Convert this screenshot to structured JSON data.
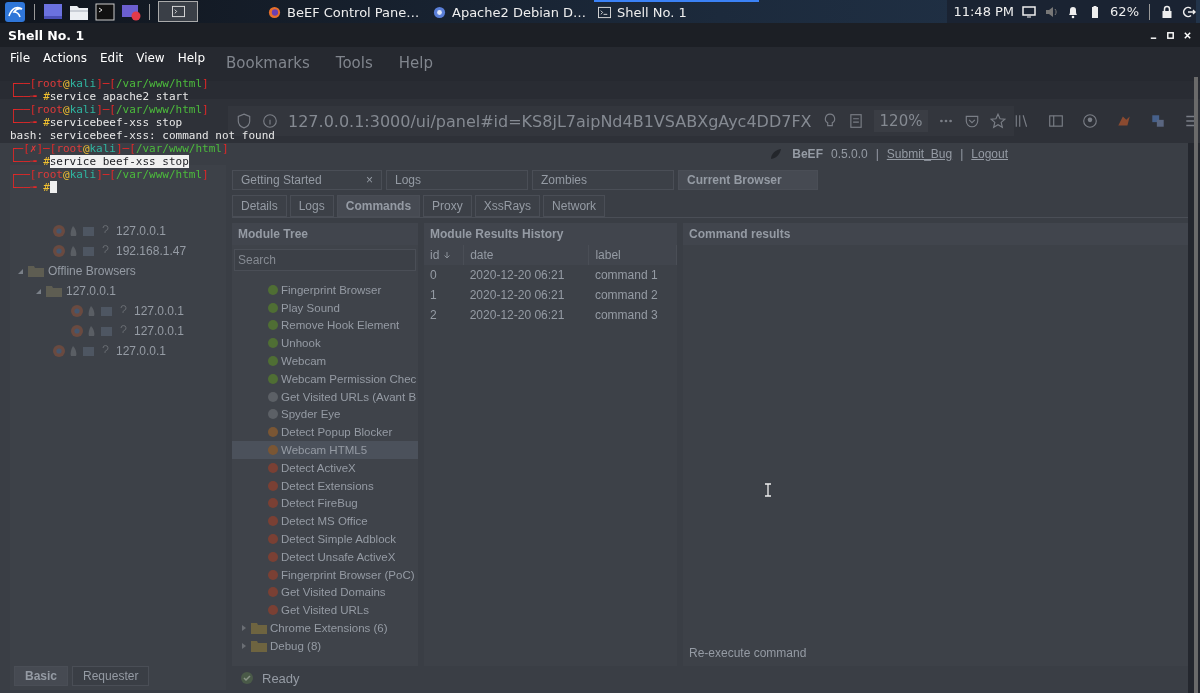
{
  "panel": {
    "tasks": [
      {
        "label": "BeEF Control Pane…",
        "kind": "browser",
        "selected": false
      },
      {
        "label": "Apache2 Debian D…",
        "kind": "web",
        "selected": false
      },
      {
        "label": "Shell No. 1",
        "kind": "terminal",
        "selected": true
      }
    ],
    "clock": "11:48 PM",
    "battery": "62%"
  },
  "browser": {
    "menu": [
      "Bookmarks",
      "Tools",
      "Help"
    ],
    "url": "127.0.0.1:3000/ui/panel#id=KS8jL7aipNd4B1VSABXgAyc4DD7FX",
    "zoom": "120%",
    "beef": {
      "header": [
        "BeEF",
        "0.5.0.0",
        "|",
        "Submit_Bug",
        "|",
        "Logout"
      ],
      "online_browsers": [
        "127.0.0.1",
        "192.168.1.47"
      ],
      "tree": [
        {
          "label": "Offline Browsers",
          "expanded": true,
          "children": [
            {
              "label": "127.0.0.1",
              "expanded": true,
              "children": [
                {
                  "label": "127.0.0.1"
                },
                {
                  "label": "127.0.0.1"
                }
              ]
            },
            {
              "label": "127.0.0.1"
            }
          ]
        }
      ],
      "bottom_tabs": [
        {
          "label": "Basic",
          "selected": true
        },
        {
          "label": "Requester",
          "selected": false
        }
      ],
      "tabs": [
        {
          "label": "Getting Started",
          "selected": false,
          "close": "×"
        },
        {
          "label": "Logs",
          "selected": false
        },
        {
          "label": "Zombies",
          "selected": false
        },
        {
          "label": "Current Browser",
          "selected": true
        }
      ],
      "subtabs": [
        {
          "label": "Details",
          "selected": false
        },
        {
          "label": "Logs",
          "selected": false
        },
        {
          "label": "Commands",
          "selected": true
        },
        {
          "label": "Proxy",
          "selected": false
        },
        {
          "label": "XssRays",
          "selected": false
        },
        {
          "label": "Network",
          "selected": false
        }
      ],
      "module_tree": {
        "title": "Module Tree",
        "placeholder": "Search",
        "items": [
          {
            "kind": "module",
            "label": "Fingerprint Browser",
            "color": "#4f6e34",
            "selected": false
          },
          {
            "kind": "module",
            "label": "Play Sound",
            "color": "#4f6e34",
            "selected": false
          },
          {
            "kind": "module",
            "label": "Remove Hook Element",
            "color": "#4f6e34",
            "selected": false
          },
          {
            "kind": "module",
            "label": "Unhook",
            "color": "#4f6e34",
            "selected": false
          },
          {
            "kind": "module",
            "label": "Webcam",
            "color": "#4f6e34",
            "selected": false
          },
          {
            "kind": "module",
            "label": "Webcam Permission Chec",
            "color": "#4f6e34",
            "selected": false
          },
          {
            "kind": "module",
            "label": "Get Visited URLs (Avant B",
            "color": "#5c6066",
            "selected": false
          },
          {
            "kind": "module",
            "label": "Spyder Eye",
            "color": "#5c6066",
            "selected": false
          },
          {
            "kind": "module",
            "label": "Detect Popup Blocker",
            "color": "#7a5634",
            "selected": false
          },
          {
            "kind": "module",
            "label": "Webcam HTML5",
            "color": "#7a5634",
            "selected": true
          },
          {
            "kind": "module",
            "label": "Detect ActiveX",
            "color": "#7a4034",
            "selected": false
          },
          {
            "kind": "module",
            "label": "Detect Extensions",
            "color": "#7a4034",
            "selected": false
          },
          {
            "kind": "module",
            "label": "Detect FireBug",
            "color": "#7a4034",
            "selected": false
          },
          {
            "kind": "module",
            "label": "Detect MS Office",
            "color": "#7a4034",
            "selected": false
          },
          {
            "kind": "module",
            "label": "Detect Simple Adblock",
            "color": "#7a4034",
            "selected": false
          },
          {
            "kind": "module",
            "label": "Detect Unsafe ActiveX",
            "color": "#7a4034",
            "selected": false
          },
          {
            "kind": "module",
            "label": "Fingerprint Browser (PoC)",
            "color": "#7a4034",
            "selected": false
          },
          {
            "kind": "module",
            "label": "Get Visited Domains",
            "color": "#7a4034",
            "selected": false
          },
          {
            "kind": "module",
            "label": "Get Visited URLs",
            "color": "#7a4034",
            "selected": false
          },
          {
            "kind": "folder",
            "label": "Chrome Extensions (6)",
            "selected": false
          },
          {
            "kind": "folder",
            "label": "Debug (8)",
            "selected": false
          }
        ]
      },
      "results": {
        "title": "Module Results History",
        "columns": [
          "id",
          "date",
          "label"
        ],
        "rows": [
          [
            "0",
            "2020-12-20 06:21",
            "command 1"
          ],
          [
            "1",
            "2020-12-20 06:21",
            "command 2"
          ],
          [
            "2",
            "2020-12-20 06:21",
            "command 3"
          ]
        ]
      },
      "command": {
        "title": "Command results",
        "action": "Re-execute command"
      },
      "status": "Ready"
    }
  },
  "terminal": {
    "title": "Shell No. 1",
    "menu": [
      "File",
      "Actions",
      "Edit",
      "View",
      "Help"
    ],
    "lines": [
      {
        "cursor": false,
        "parts": [
          {
            "t": "┌──[",
            "kind": "frame"
          },
          {
            "t": "root",
            "kind": "user"
          },
          {
            "t": "@",
            "kind": "at"
          },
          {
            "t": "kali",
            "kind": "host"
          },
          {
            "t": "]─[",
            "kind": "frame"
          },
          {
            "t": "/var/www/html",
            "kind": "path"
          },
          {
            "t": "]",
            "kind": "frame"
          }
        ]
      },
      {
        "cursor": false,
        "parts": [
          {
            "t": "└──╼ ",
            "kind": "frame"
          },
          {
            "t": "#",
            "kind": "at"
          },
          {
            "t": "service apache2 start",
            "kind": "text"
          }
        ]
      },
      {
        "cursor": false,
        "parts": [
          {
            "t": "┌──[",
            "kind": "frame"
          },
          {
            "t": "root",
            "kind": "user"
          },
          {
            "t": "@",
            "kind": "at"
          },
          {
            "t": "kali",
            "kind": "host"
          },
          {
            "t": "]─[",
            "kind": "frame"
          },
          {
            "t": "/var/www/html",
            "kind": "path"
          },
          {
            "t": "]",
            "kind": "frame"
          }
        ]
      },
      {
        "cursor": false,
        "parts": [
          {
            "t": "└──╼ ",
            "kind": "frame"
          },
          {
            "t": "#",
            "kind": "at"
          },
          {
            "t": "servicebeef-xss stop",
            "kind": "text"
          }
        ]
      },
      {
        "cursor": false,
        "parts": [
          {
            "t": "bash: servicebeef-xss: command not found",
            "kind": "text"
          }
        ]
      },
      {
        "cursor": false,
        "parts": [
          {
            "t": "┌─[",
            "kind": "frame"
          },
          {
            "t": "✗",
            "kind": "user"
          },
          {
            "t": "]─[",
            "kind": "frame"
          },
          {
            "t": "root",
            "kind": "user"
          },
          {
            "t": "@",
            "kind": "at"
          },
          {
            "t": "kali",
            "kind": "host"
          },
          {
            "t": "]─[",
            "kind": "frame"
          },
          {
            "t": "/var/www/html",
            "kind": "path"
          },
          {
            "t": "]",
            "kind": "frame"
          }
        ]
      },
      {
        "cursor": false,
        "parts": [
          {
            "t": "└──╼ ",
            "kind": "frame"
          },
          {
            "t": "#",
            "kind": "at"
          },
          {
            "t": "service beef-xss stop",
            "kind": "selected"
          }
        ]
      },
      {
        "cursor": false,
        "parts": [
          {
            "t": "┌──[",
            "kind": "frame"
          },
          {
            "t": "root",
            "kind": "user"
          },
          {
            "t": "@",
            "kind": "at"
          },
          {
            "t": "kali",
            "kind": "host"
          },
          {
            "t": "]─[",
            "kind": "frame"
          },
          {
            "t": "/var/www/html",
            "kind": "path"
          },
          {
            "t": "]",
            "kind": "frame"
          }
        ]
      },
      {
        "cursor": true,
        "parts": [
          {
            "t": "└──╼ ",
            "kind": "frame"
          },
          {
            "t": "#",
            "kind": "at"
          }
        ]
      }
    ]
  }
}
